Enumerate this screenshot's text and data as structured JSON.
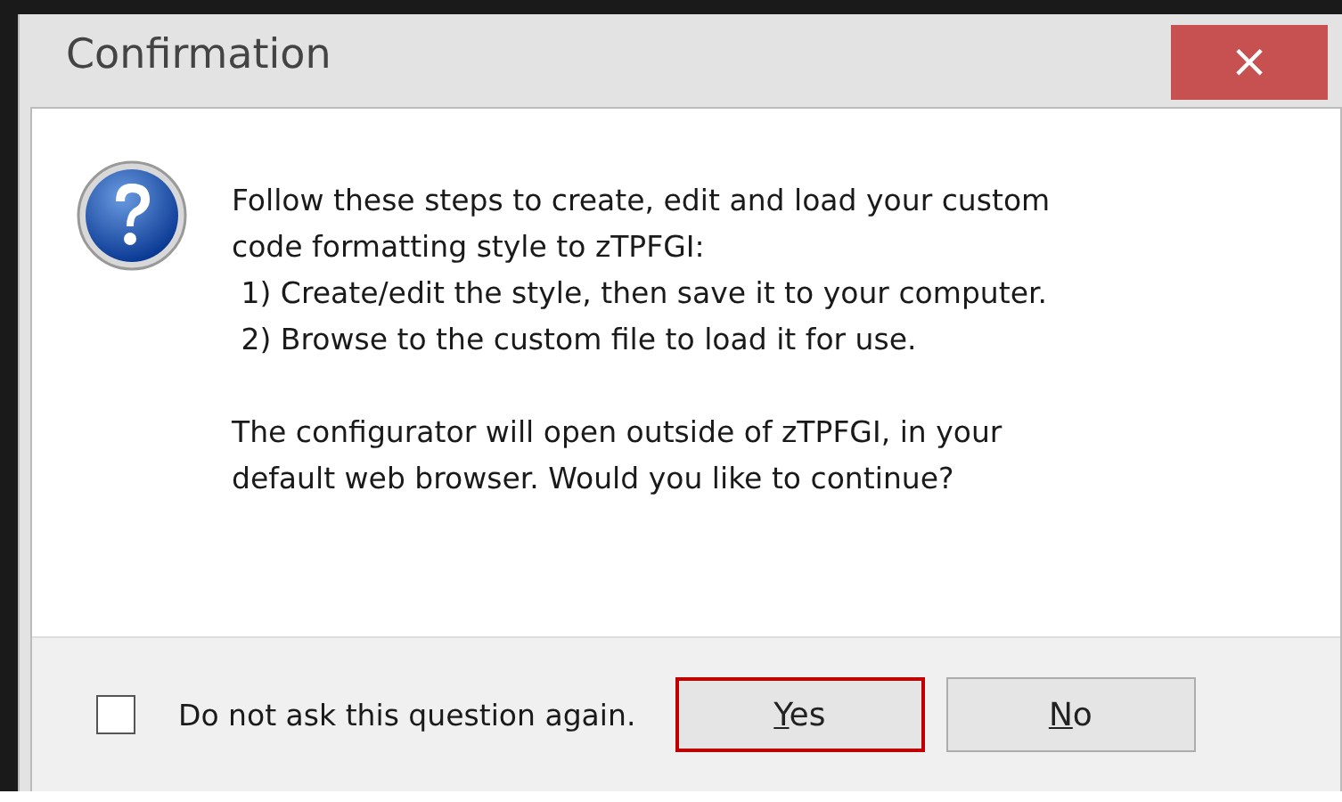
{
  "window": {
    "title": "Confirmation",
    "close_label": "×"
  },
  "message": {
    "paragraphs": [
      {
        "lines": [
          "Follow these steps to create, edit and load your custom",
          "code formatting style to zTPFGI:",
          " 1) Create/edit the style, then save it to your computer.",
          " 2) Browse to the custom file to load it for use."
        ]
      },
      {
        "lines": [
          "The configurator will open outside of zTPFGI, in your",
          "default web browser. Would you like to continue?"
        ]
      }
    ]
  },
  "checkbox": {
    "label": "Do not ask this question again.",
    "checked": false
  },
  "buttons": [
    {
      "label": "Yes",
      "selected": true,
      "access_key_underlined": true
    },
    {
      "label": "No",
      "selected": false,
      "access_key_underlined": true
    }
  ]
}
